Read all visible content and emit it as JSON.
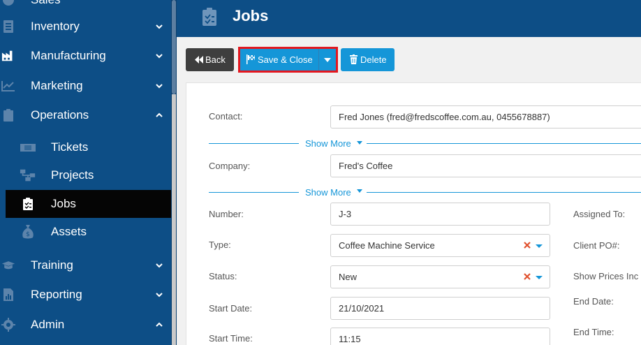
{
  "sidebar": {
    "items": [
      {
        "label": "Sales",
        "icon": "sales-icon"
      },
      {
        "label": "Inventory",
        "icon": "inventory-icon"
      },
      {
        "label": "Manufacturing",
        "icon": "factory-icon"
      },
      {
        "label": "Marketing",
        "icon": "chart-line-icon"
      },
      {
        "label": "Operations",
        "icon": "clipboard-icon"
      },
      {
        "label": "Training",
        "icon": "graduation-cap-icon"
      },
      {
        "label": "Reporting",
        "icon": "report-icon"
      },
      {
        "label": "Admin",
        "icon": "gear-icon"
      }
    ],
    "sub_items": [
      {
        "label": "Tickets",
        "icon": "ticket-icon"
      },
      {
        "label": "Projects",
        "icon": "sitemap-icon"
      },
      {
        "label": "Jobs",
        "icon": "clipboard-check-icon"
      },
      {
        "label": "Assets",
        "icon": "money-bag-icon"
      }
    ]
  },
  "header": {
    "title": "Jobs",
    "icon": "clipboard-icon"
  },
  "toolbar": {
    "back_label": "Back",
    "save_label": "Save & Close",
    "delete_label": "Delete"
  },
  "form": {
    "contact_label": "Contact:",
    "contact_value": "Fred Jones (fred@fredscoffee.com.au, 0455678887)",
    "show_more_1": "Show More",
    "company_label": "Company:",
    "company_value": "Fred's Coffee",
    "show_more_2": "Show More",
    "number_label": "Number:",
    "number_value": "J-3",
    "type_label": "Type:",
    "type_value": "Coffee Machine Service",
    "status_label": "Status:",
    "status_value": "New",
    "start_date_label": "Start Date:",
    "start_date_value": "21/10/2021",
    "start_time_label": "Start Time:",
    "start_time_value": "11:15",
    "assigned_to_label": "Assigned To:",
    "client_po_label": "Client PO#:",
    "show_prices_label": "Show Prices Inc",
    "end_date_label": "End Date:",
    "end_time_label": "End Time:"
  },
  "colors": {
    "sidebar_bg": "#0d4e86",
    "accent": "#1596d8",
    "highlight_border": "#e3171f",
    "active_item_bg": "#050505",
    "clear_x": "#e0522f"
  }
}
